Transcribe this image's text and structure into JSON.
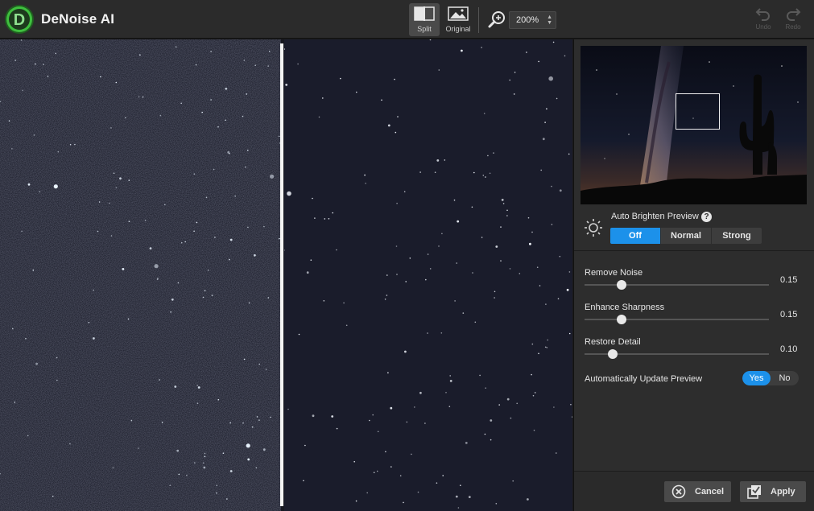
{
  "app": {
    "title": "DeNoise AI"
  },
  "toolbar": {
    "split_label": "Split",
    "original_label": "Original",
    "zoom_value": "200%",
    "undo_label": "Undo",
    "redo_label": "Redo"
  },
  "panel": {
    "auto_brighten": {
      "label": "Auto Brighten Preview",
      "help": "?",
      "options": [
        "Off",
        "Normal",
        "Strong"
      ],
      "selected": "Off"
    },
    "sliders": [
      {
        "label": "Remove Noise",
        "value": "0.15",
        "fraction": 0.15
      },
      {
        "label": "Enhance Sharpness",
        "value": "0.15",
        "fraction": 0.15
      },
      {
        "label": "Restore Detail",
        "value": "0.10",
        "fraction": 0.1
      }
    ],
    "auto_update": {
      "label": "Automatically Update Preview",
      "yes": "Yes",
      "no": "No",
      "selected": "Yes"
    }
  },
  "actions": {
    "cancel": "Cancel",
    "apply": "Apply"
  },
  "colors": {
    "accent": "#1c91ea",
    "logo_green": "#3fbf3f",
    "panel_bg": "#2d2d2d"
  }
}
